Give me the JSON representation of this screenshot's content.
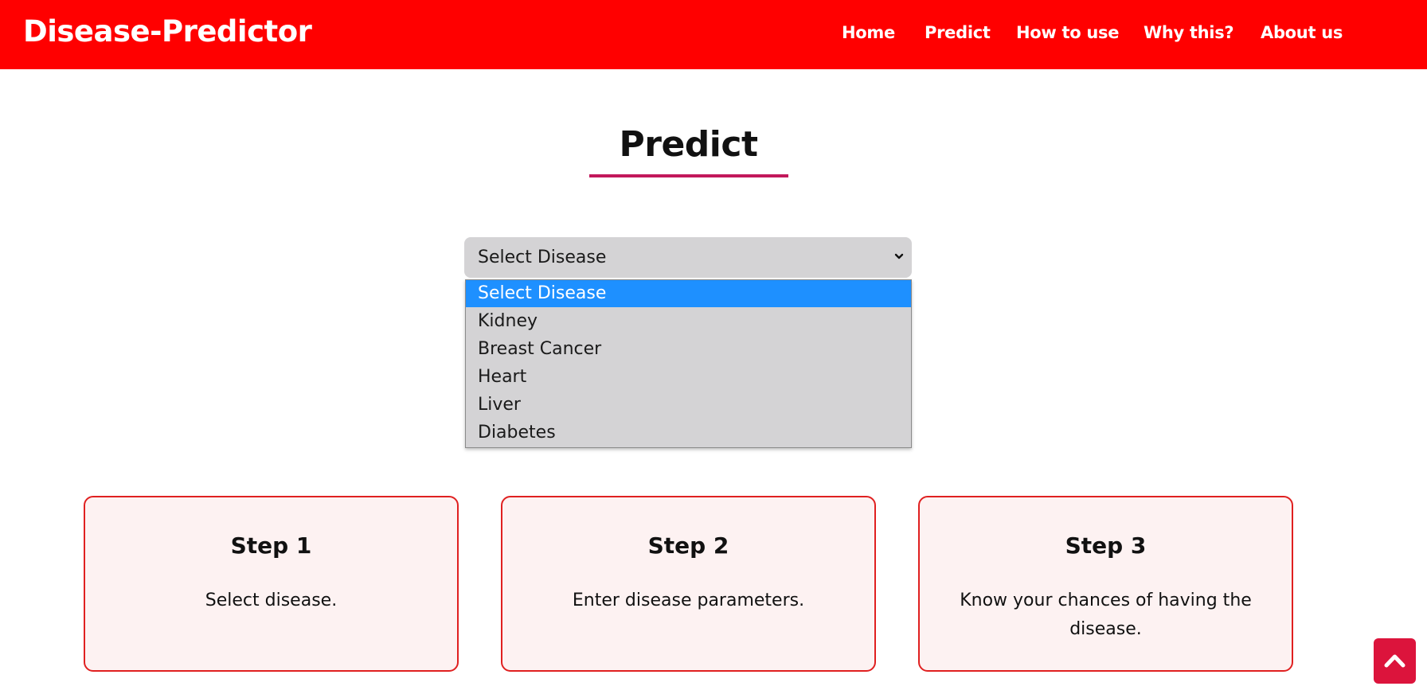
{
  "navbar": {
    "brand": "Disease-Predictor",
    "links": [
      "Home",
      "Predict",
      "How to use",
      "Why this?",
      "About us"
    ],
    "background_color": "#ff0000"
  },
  "page": {
    "title": "Predict",
    "accent_color": "#c2185b"
  },
  "disease_select": {
    "selected_value": "Select Disease",
    "options": [
      "Select Disease",
      "Kidney",
      "Breast Cancer",
      "Heart",
      "Liver",
      "Diabetes"
    ],
    "highlight_color": "#1e90ff"
  },
  "steps": [
    {
      "title": "Step 1",
      "text": "Select disease."
    },
    {
      "title": "Step 2",
      "text": "Enter disease parameters."
    },
    {
      "title": "Step 3",
      "text": "Know your chances of having the disease."
    }
  ],
  "scroll_top_button": {
    "icon": "chevron-up-icon",
    "color": "#dc143c"
  }
}
